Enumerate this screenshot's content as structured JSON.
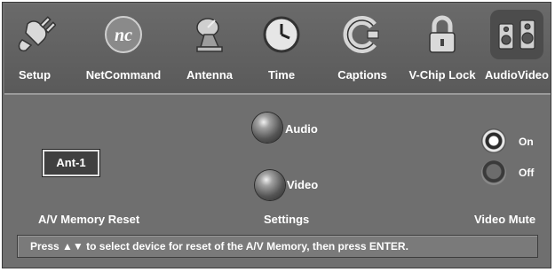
{
  "nav": {
    "items": [
      {
        "label": "Setup",
        "icon": "plug-icon"
      },
      {
        "label": "NetCommand",
        "icon": "netcommand-logo-icon"
      },
      {
        "label": "Antenna",
        "icon": "antenna-icon"
      },
      {
        "label": "Time",
        "icon": "clock-icon"
      },
      {
        "label": "Captions",
        "icon": "captions-icon"
      },
      {
        "label": "V-Chip Lock",
        "icon": "padlock-icon"
      },
      {
        "label": "AudioVideo",
        "icon": "speakers-icon",
        "active": true
      }
    ]
  },
  "memory_reset": {
    "input_value": "Ant-1",
    "label": "A/V Memory Reset"
  },
  "settings": {
    "audio_label": "Audio",
    "video_label": "Video",
    "label": "Settings"
  },
  "video_mute": {
    "on_label": "On",
    "off_label": "Off",
    "selected": "On",
    "label": "Video Mute"
  },
  "status": {
    "prefix": "Press ",
    "arrows": "▲▼",
    "suffix": " to select device for reset of the A/V Memory, then press ENTER."
  },
  "colors": {
    "panel": "#6f6f6f",
    "text": "#ffffff",
    "accent_highlight": "#4c4c4c"
  }
}
